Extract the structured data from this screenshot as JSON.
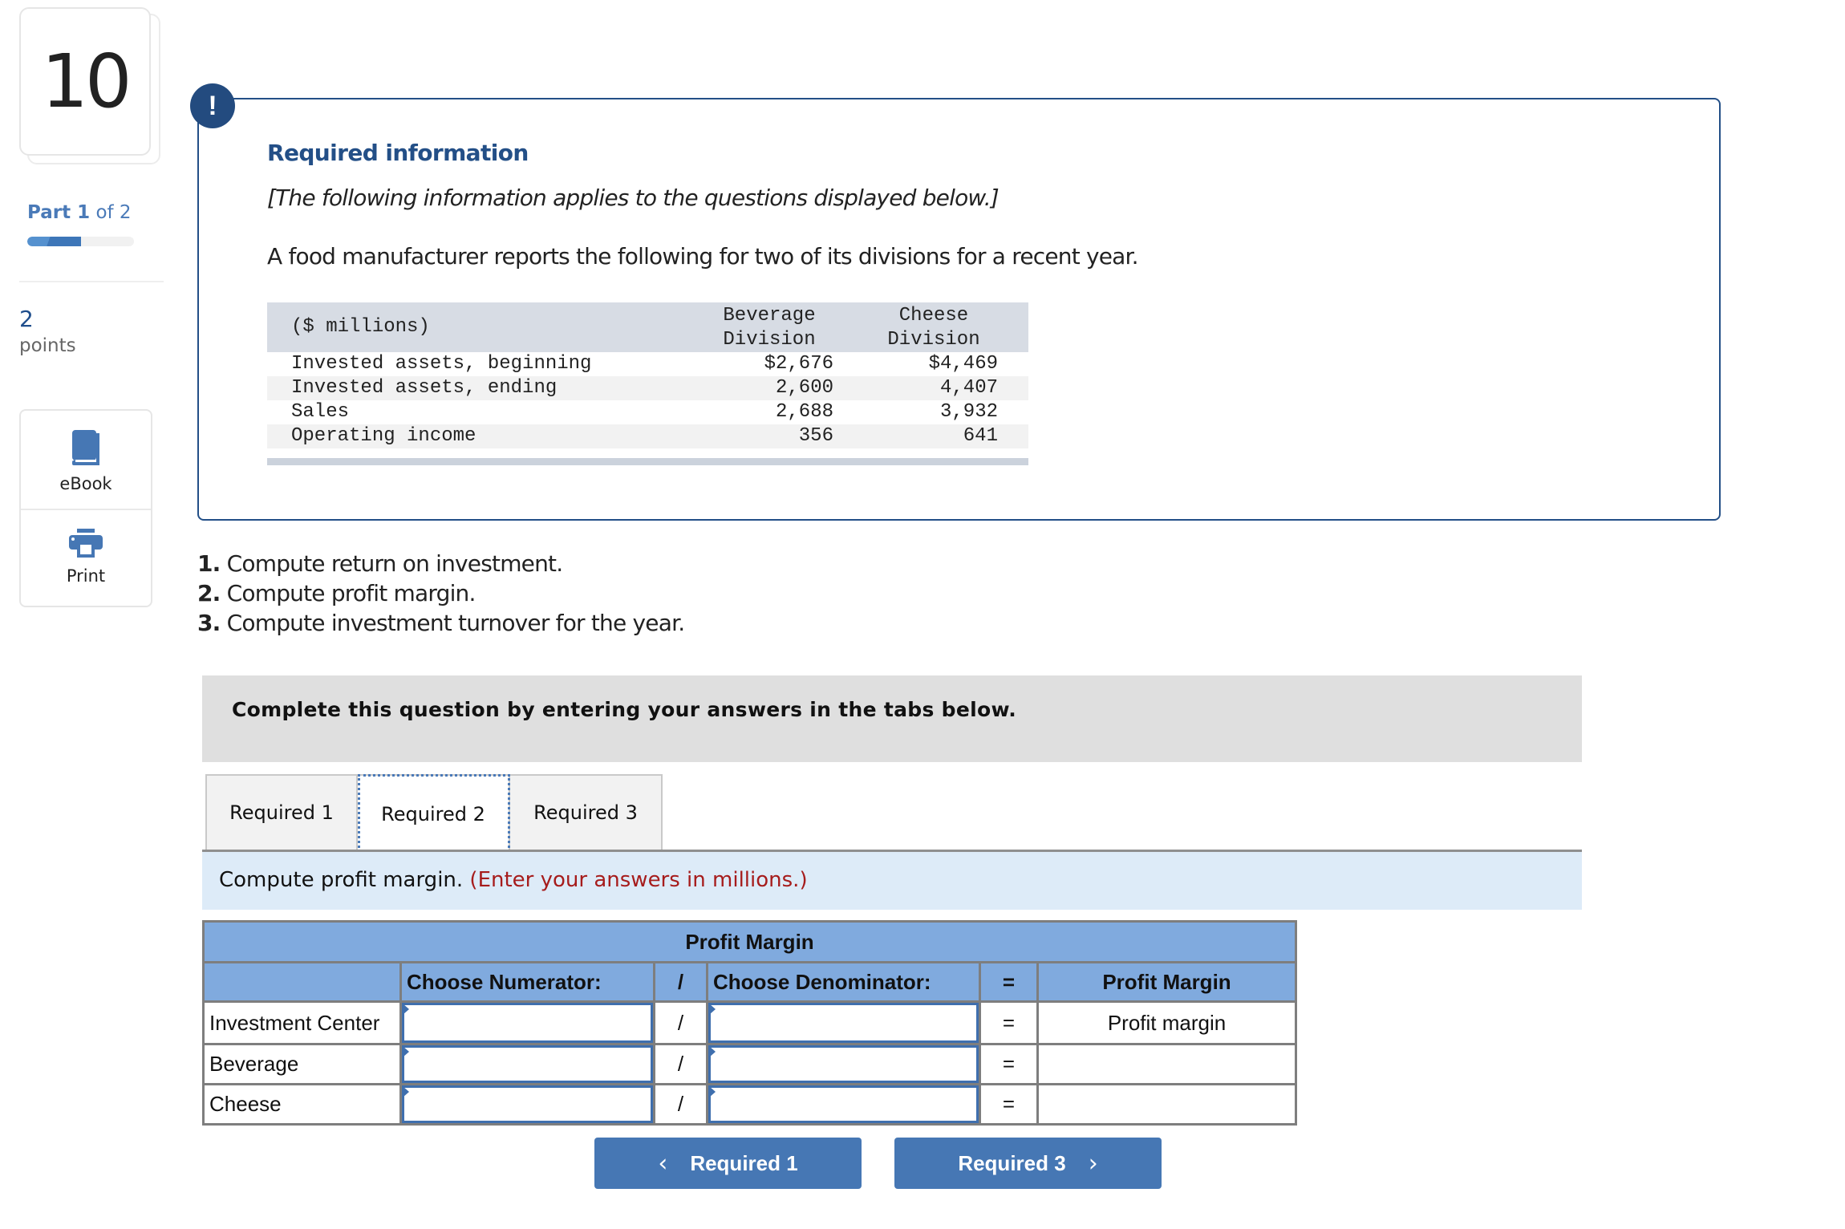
{
  "sidebar": {
    "question_number": "10",
    "part": {
      "prefix": "Part",
      "current": "1",
      "suffix": "of 2",
      "progress_fraction": 0.5
    },
    "points_value": "2",
    "points_label": "points",
    "tools": [
      {
        "label": "eBook",
        "icon": "book-icon"
      },
      {
        "label": "Print",
        "icon": "printer-icon"
      }
    ]
  },
  "info": {
    "alert_icon": "!",
    "title": "Required information",
    "italic_note": "[The following information applies to the questions displayed below.]",
    "intro": "A food manufacturer reports the following for two of its divisions for a recent year.",
    "table": {
      "unit_label": "($ millions)",
      "columns": [
        {
          "line1": "Beverage",
          "line2": "Division"
        },
        {
          "line1": "Cheese",
          "line2": "Division"
        }
      ],
      "rows": [
        {
          "label": "Invested assets, beginning",
          "beverage": "$2,676",
          "cheese": "$4,469"
        },
        {
          "label": "Invested assets, ending",
          "beverage": "2,600",
          "cheese": "4,407"
        },
        {
          "label": "Sales",
          "beverage": "2,688",
          "cheese": "3,932"
        },
        {
          "label": "Operating income",
          "beverage": "356",
          "cheese": "641"
        }
      ]
    }
  },
  "questions": [
    {
      "num": "1.",
      "text": "Compute return on investment."
    },
    {
      "num": "2.",
      "text": "Compute profit margin."
    },
    {
      "num": "3.",
      "text": "Compute investment turnover for the year."
    }
  ],
  "complete_banner": "Complete this question by entering your answers in the tabs below.",
  "tabs": [
    {
      "label": "Required 1",
      "active": false
    },
    {
      "label": "Required 2",
      "active": true
    },
    {
      "label": "Required 3",
      "active": false
    }
  ],
  "instruction": {
    "text": "Compute profit margin.",
    "note": "(Enter your answers in millions.)"
  },
  "answer_table": {
    "title": "Profit Margin",
    "headers": {
      "center": "",
      "numerator": "Choose Numerator:",
      "divide": "/",
      "denominator": "Choose Denominator:",
      "equals": "=",
      "result": "Profit Margin"
    },
    "rows": [
      {
        "label": "Investment Center",
        "numerator": "",
        "divide": "/",
        "denominator": "",
        "equals": "=",
        "result": "Profit margin"
      },
      {
        "label": "Beverage",
        "numerator": "",
        "divide": "/",
        "denominator": "",
        "equals": "=",
        "result": ""
      },
      {
        "label": "Cheese",
        "numerator": "",
        "divide": "/",
        "denominator": "",
        "equals": "=",
        "result": ""
      }
    ]
  },
  "nav": {
    "prev_label": "Required 1",
    "next_label": "Required 3",
    "prev_chevron": "‹",
    "next_chevron": "›"
  },
  "colors": {
    "brand_blue": "#234f87",
    "button_blue": "#4677b4",
    "table_header_blue": "#80aade",
    "instruction_bg": "#ddebf8",
    "note_red": "#a61c1c"
  }
}
